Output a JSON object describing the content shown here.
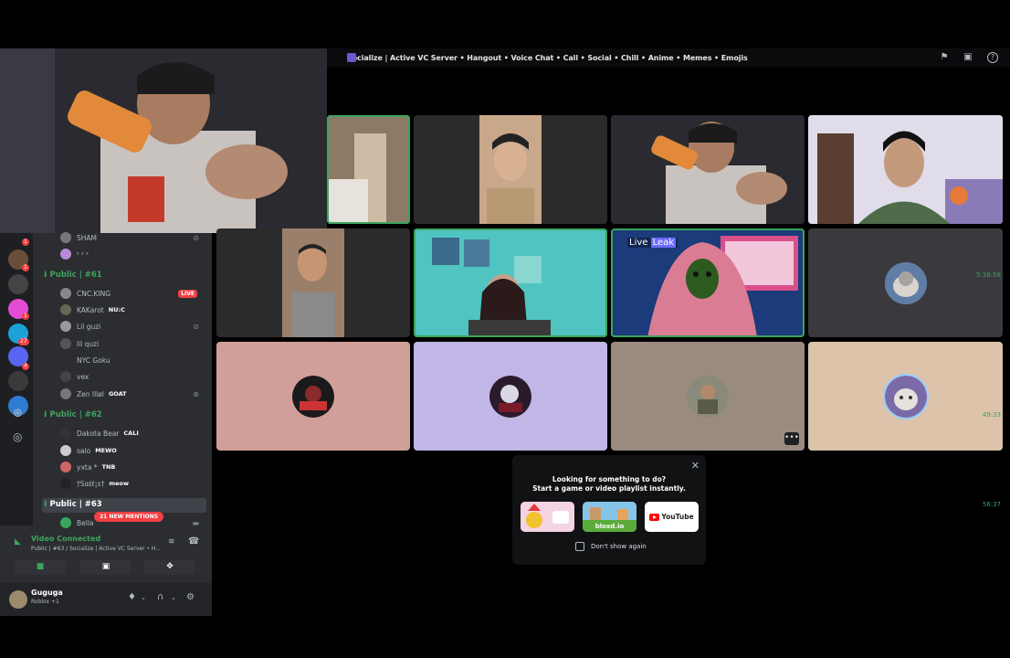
{
  "window": {
    "title": "Socialize | Active VC Server • Hangout • Voice Chat • Call • Social • Chill • Anime • Memes • Emojis"
  },
  "toolbar_icons": [
    "flag-icon",
    "window-icon",
    "help-icon"
  ],
  "guild_badges": [
    "1",
    "1",
    "1",
    "27",
    "4"
  ],
  "voice_channels": [
    {
      "name": "Public | #61",
      "time": "5:38:58"
    },
    {
      "name": "Public | #62",
      "time": "49:33"
    },
    {
      "name": "Public | #63",
      "time": "56:37"
    }
  ],
  "users_top": [
    {
      "name": "SHAM"
    },
    {
      "name": "ᶻ ᶻ ᶻ"
    }
  ],
  "users_61": [
    {
      "name": "CNC.KING",
      "live": "LIVE"
    },
    {
      "name": "KAKarot",
      "tag": "NU:C"
    },
    {
      "name": "Lil guzi"
    },
    {
      "name": "lil quzi"
    },
    {
      "name": "NYC Goku"
    },
    {
      "name": "vex"
    },
    {
      "name": "Zen Illøl",
      "tag": "GOAT"
    }
  ],
  "users_62": [
    {
      "name": "Dakota Bear",
      "tag": "CALI"
    },
    {
      "name": "salo",
      "tag": "MEWO"
    },
    {
      "name": "yxta *",
      "tag": "TNB"
    },
    {
      "name": "†Sαℓℓ¡ѕ†",
      "tag": "meow"
    }
  ],
  "users_63": [
    {
      "name": "Bella"
    }
  ],
  "mentions_label": "21 NEW MENTIONS",
  "voice_status": {
    "title": "Video Connected",
    "subtitle": "Public | #63 / Socialize | Active VC Server • H..."
  },
  "user_panel": {
    "name": "Guguga",
    "status": "Roblox +1"
  },
  "live_tile_label": {
    "live": "Live",
    "leak": "Leak"
  },
  "activity": {
    "heading": "Looking for something to do?",
    "subheading": "Start a game or video playlist instantly.",
    "cards": [
      "bloxd.io",
      "YouTube"
    ],
    "dont_show": "Don't show again"
  },
  "colors": {
    "accent_green": "#3ba55d",
    "live_red": "#ed4245",
    "tile_pink": "#d19f99",
    "tile_lavender": "#c1b6e6",
    "tile_taupe": "#9a8a80",
    "tile_beige": "#dcc3aa"
  }
}
